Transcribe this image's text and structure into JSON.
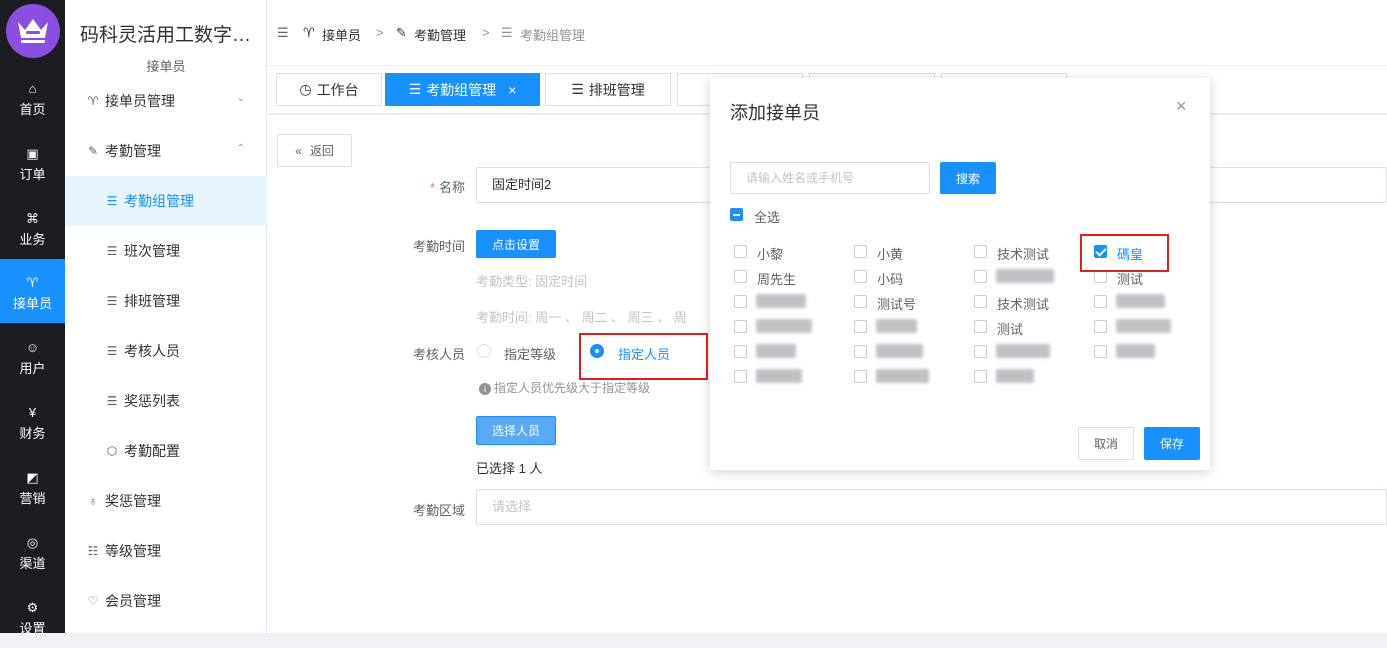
{
  "app": {
    "title": "码科灵活用工数字…",
    "subtitle": "接单员"
  },
  "rail": [
    {
      "icon": "home-icon",
      "glyph": "⌂",
      "label": "首页"
    },
    {
      "icon": "order-icon",
      "glyph": "▣",
      "label": "订单"
    },
    {
      "icon": "command-icon",
      "glyph": "⌘",
      "label": "业务"
    },
    {
      "icon": "bike-icon",
      "glyph": "♈",
      "label": "接单员"
    },
    {
      "icon": "user-icon",
      "glyph": "☺",
      "label": "用户"
    },
    {
      "icon": "yen-icon",
      "glyph": "¥",
      "label": "财务"
    },
    {
      "icon": "chart-icon",
      "glyph": "◩",
      "label": "营销"
    },
    {
      "icon": "channel-icon",
      "glyph": "◎",
      "label": "渠道"
    },
    {
      "icon": "settings-icon",
      "glyph": "⚙",
      "label": "设置"
    }
  ],
  "menu": [
    {
      "icon": "bike-icon",
      "glyph": "♈",
      "label": "接单员管理",
      "arrow": "⌄"
    },
    {
      "icon": "edit-icon",
      "glyph": "✎",
      "label": "考勤管理",
      "arrow": "⌃"
    },
    {
      "icon": "list-icon",
      "glyph": "☰",
      "label": "考勤组管理"
    },
    {
      "icon": "list-icon",
      "glyph": "☰",
      "label": "班次管理"
    },
    {
      "icon": "list-icon",
      "glyph": "☰",
      "label": "排班管理"
    },
    {
      "icon": "list-icon",
      "glyph": "☰",
      "label": "考核人员"
    },
    {
      "icon": "list-icon",
      "glyph": "☰",
      "label": "奖惩列表"
    },
    {
      "icon": "hexagon-icon",
      "glyph": "⬡",
      "label": "考勤配置"
    },
    {
      "icon": "medal-icon",
      "glyph": "♁",
      "label": "奖惩管理"
    },
    {
      "icon": "level-icon",
      "glyph": "☷",
      "label": "等级管理"
    },
    {
      "icon": "vip-icon",
      "glyph": "♡",
      "label": "会员管理"
    }
  ],
  "breadcrumb": {
    "fold_glyph": "☰",
    "item1": "接单员",
    "sep1": ">",
    "item2": "考勤管理",
    "sep2": ">",
    "item3": "考勤组管理"
  },
  "tabs": [
    {
      "label": "工作台",
      "glyph": "◷"
    },
    {
      "label": "考勤组管理",
      "glyph": "☰",
      "close": "×"
    },
    {
      "label": "排班管理",
      "glyph": "☰"
    }
  ],
  "form": {
    "back": "返回",
    "back_glyph": "«",
    "name_label": "名称",
    "name_required": "*",
    "name_value": "固定时间2",
    "time_label": "考勤时间",
    "time_button": "点击设置",
    "type_text": "考勤类型:  固定时间",
    "days_text": "考勤时间:  周一 、 周二 、 周三 、 周",
    "staff_label": "考核人员",
    "radio_level": "指定等级",
    "radio_person": "指定人员",
    "hint": "指定人员优先级大于指定等级",
    "hint_glyph": "i",
    "choose_button": "选择人员",
    "selected_text": "已选择 1 人",
    "area_label": "考勤区域",
    "area_placeholder": "请选择"
  },
  "dialog": {
    "title": "添加接单员",
    "close": "×",
    "search_placeholder": "请输入姓名或手机号",
    "search_button": "搜索",
    "select_all": "全选",
    "people": [
      {
        "label": "小黎",
        "checked": false
      },
      {
        "label": "小黄",
        "checked": false
      },
      {
        "label": "技术测试",
        "checked": false
      },
      {
        "label": "碼皇",
        "checked": true
      },
      {
        "label": "周先生",
        "checked": false
      },
      {
        "label": "小码",
        "checked": false
      },
      {
        "label": "",
        "checked": false
      },
      {
        "label": "测试",
        "checked": false
      },
      {
        "label": "",
        "checked": false
      },
      {
        "label": "测试号",
        "checked": false
      },
      {
        "label": "技术测试",
        "checked": false
      },
      {
        "label": "",
        "checked": false
      },
      {
        "label": "",
        "checked": false
      },
      {
        "label": "",
        "checked": false
      },
      {
        "label": "测试",
        "checked": false
      },
      {
        "label": "",
        "checked": false
      },
      {
        "label": "",
        "checked": false
      },
      {
        "label": "",
        "checked": false
      },
      {
        "label": "",
        "checked": false
      },
      {
        "label": "",
        "checked": false
      },
      {
        "label": "",
        "checked": false
      },
      {
        "label": "",
        "checked": false
      },
      {
        "label": "",
        "checked": false
      }
    ],
    "cancel": "取消",
    "save": "保存"
  },
  "colors": {
    "primary": "#1890ff",
    "rail_bg": "#1c1d22",
    "logo_bg": "#8a4fe0",
    "highlight": "#e02020"
  }
}
